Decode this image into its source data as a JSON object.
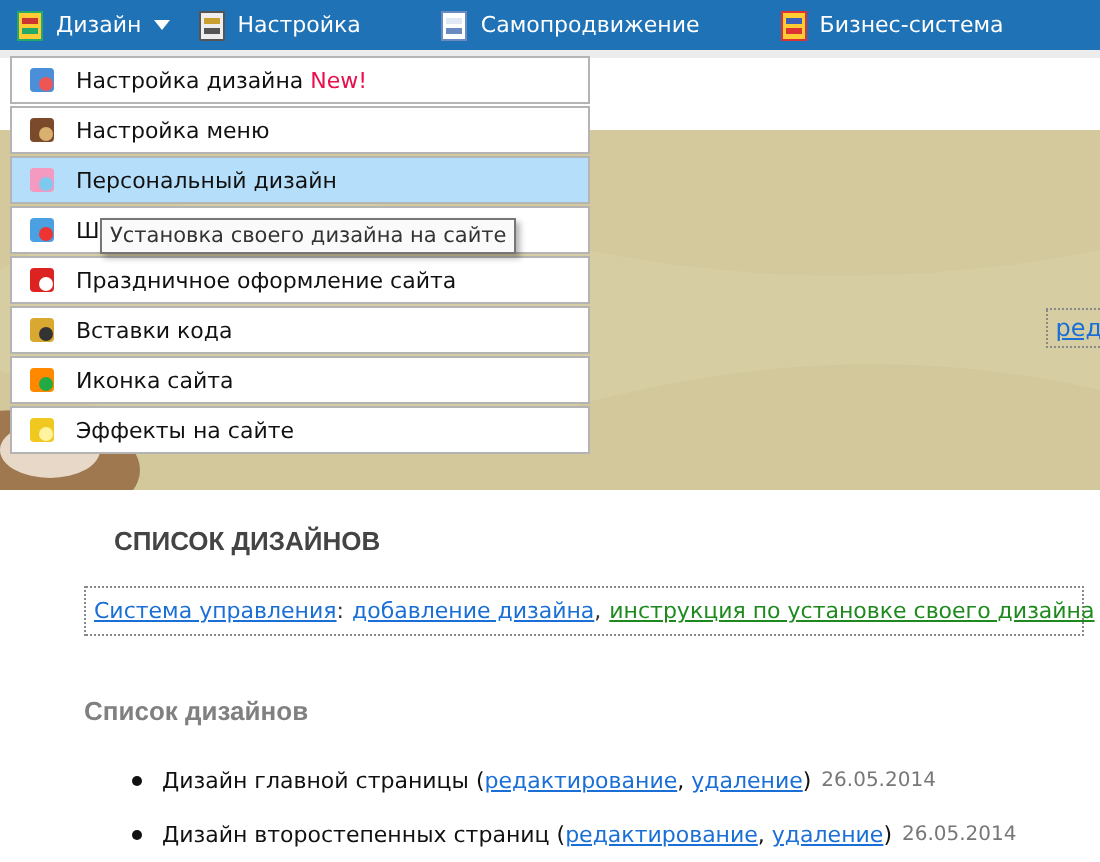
{
  "nav": [
    {
      "label": "Дизайн",
      "has_menu": true
    },
    {
      "label": "Настройка",
      "has_menu": false
    },
    {
      "label": "Самопродвижение",
      "has_menu": false
    },
    {
      "label": "Бизнес-система",
      "has_menu": false
    }
  ],
  "menu": {
    "items": [
      {
        "label": "Настройка дизайна",
        "badge": "New!",
        "selected": false
      },
      {
        "label": "Настройка меню",
        "selected": false
      },
      {
        "label": "Персональный дизайн",
        "selected": true
      },
      {
        "label": "Ш",
        "selected": false
      },
      {
        "label": "Праздничное оформление сайта",
        "selected": false
      },
      {
        "label": "Вставки кода",
        "selected": false
      },
      {
        "label": "Иконка сайта",
        "selected": false
      },
      {
        "label": "Эффекты на сайте",
        "selected": false
      }
    ],
    "tooltip": "Установка своего дизайна на сайте"
  },
  "banner": {
    "link": "ред"
  },
  "heading": "СПИСОК ДИЗАЙНОВ",
  "control_links": [
    {
      "label": "Система управления",
      "color": "#1a6fd6",
      "after": ":"
    },
    {
      "label": "добавление дизайна",
      "color": "#1a6fd6",
      "after": ","
    },
    {
      "label": "инструкция по установке своего дизайна",
      "color": "#1e8a1e"
    }
  ],
  "section_title": "Список дизайнов",
  "designs": [
    {
      "name": "Дизайн главной страницы",
      "open": "(",
      "edit": "редактирование",
      "between": ",",
      "delete": "удаление",
      "close": ")",
      "date": "26.05.2014"
    },
    {
      "name": "Дизайн второстепенных страниц",
      "open": "(",
      "edit": "редактирование",
      "between": ",",
      "delete": "удаление",
      "close": ")",
      "date": "26.05.2014"
    }
  ]
}
